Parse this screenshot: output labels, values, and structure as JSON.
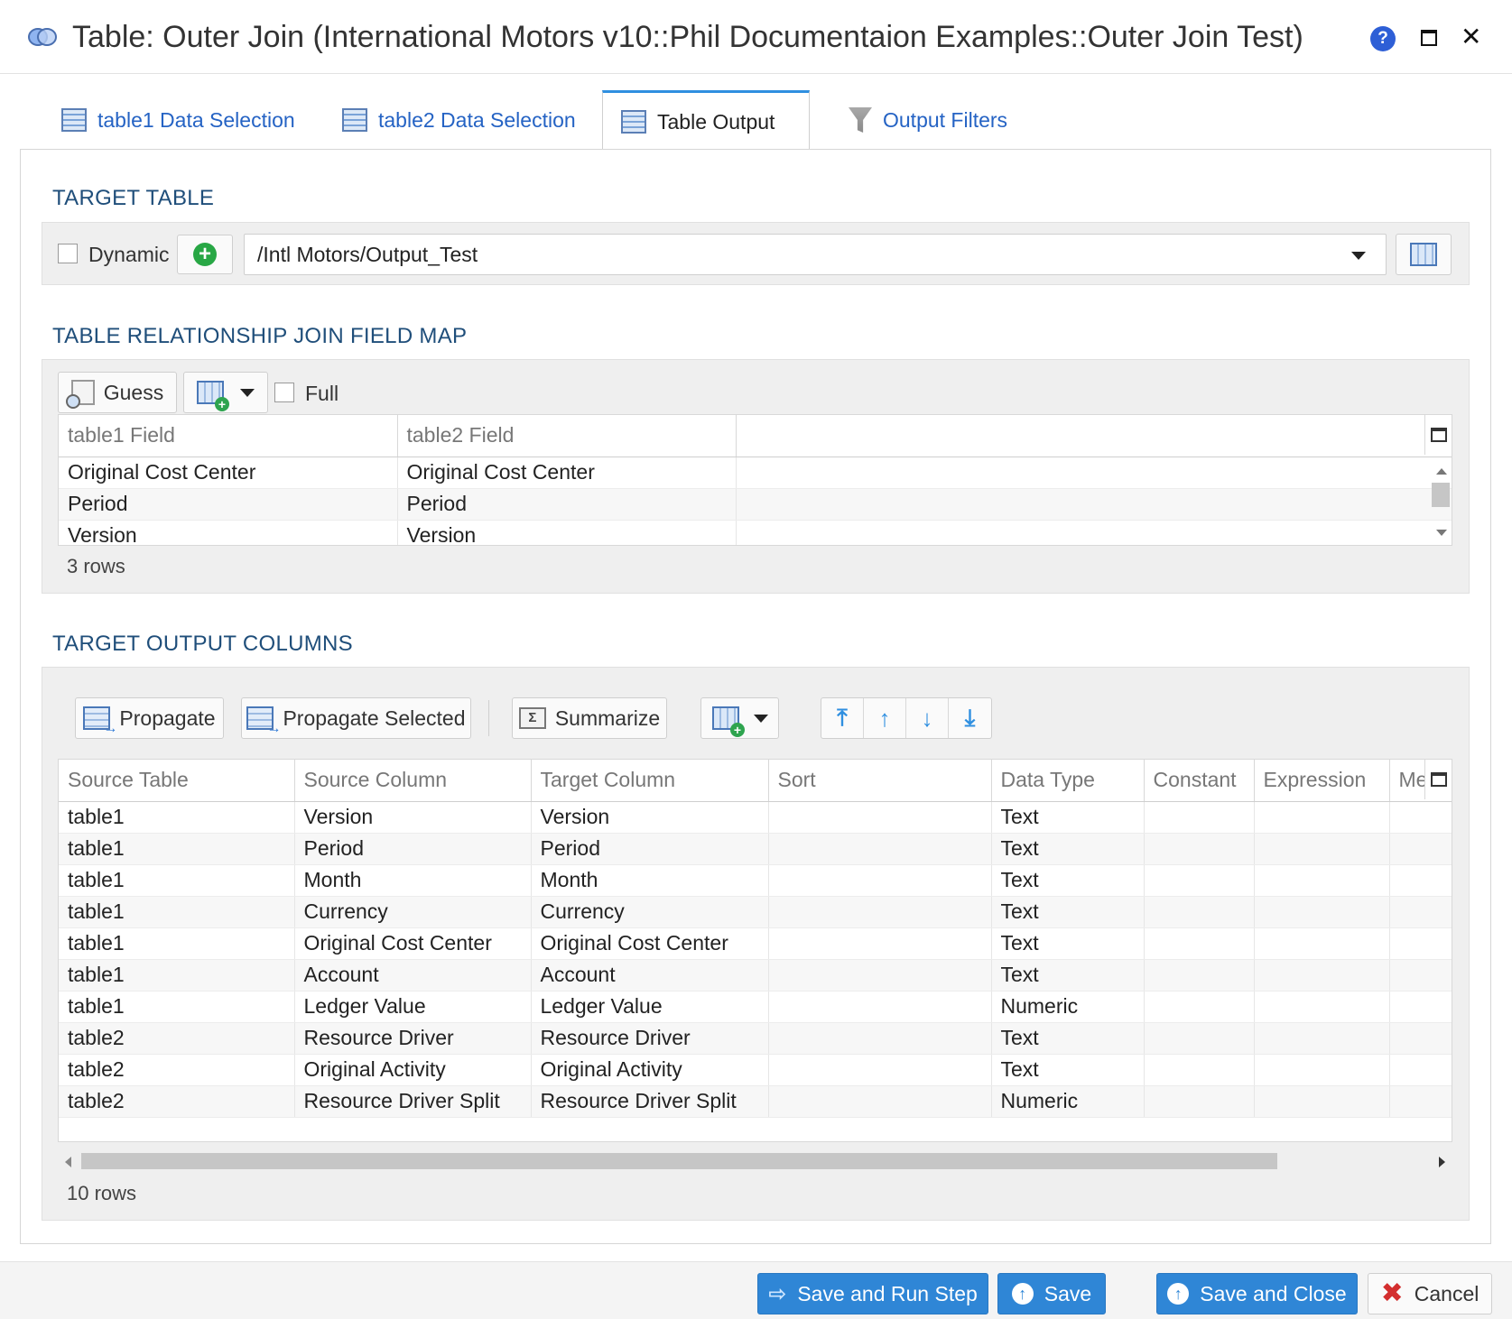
{
  "window": {
    "title": "Table: Outer Join (International Motors v10::Phil Documentaion Examples::Outer Join Test)",
    "help_label": "?"
  },
  "tabs": [
    {
      "label": "table1 Data Selection",
      "active": false
    },
    {
      "label": "table2 Data Selection",
      "active": false
    },
    {
      "label": "Table Output",
      "active": true
    },
    {
      "label": "Output Filters",
      "active": false
    }
  ],
  "target_table": {
    "heading": "TARGET TABLE",
    "dynamic_label": "Dynamic",
    "dynamic_checked": false,
    "selected_table": "/Intl Motors/Output_Test"
  },
  "join_map": {
    "heading": "TABLE RELATIONSHIP JOIN FIELD MAP",
    "guess_label": "Guess",
    "full_label": "Full",
    "full_checked": false,
    "columns": [
      "table1 Field",
      "table2 Field",
      ""
    ],
    "rows": [
      [
        "Original Cost Center",
        "Original Cost Center",
        ""
      ],
      [
        "Period",
        "Period",
        ""
      ],
      [
        "Version",
        "Version",
        ""
      ]
    ],
    "row_count": "3 rows"
  },
  "output_columns": {
    "heading": "TARGET OUTPUT COLUMNS",
    "propagate_label": "Propagate",
    "propagate_selected_label": "Propagate Selected",
    "summarize_label": "Summarize",
    "columns": [
      "Source Table",
      "Source Column",
      "Target Column",
      "Sort",
      "Data Type",
      "Constant",
      "Expression",
      "Me"
    ],
    "rows": [
      [
        "table1",
        "Version",
        "Version",
        "",
        "Text",
        "",
        "",
        ""
      ],
      [
        "table1",
        "Period",
        "Period",
        "",
        "Text",
        "",
        "",
        ""
      ],
      [
        "table1",
        "Month",
        "Month",
        "",
        "Text",
        "",
        "",
        ""
      ],
      [
        "table1",
        "Currency",
        "Currency",
        "",
        "Text",
        "",
        "",
        ""
      ],
      [
        "table1",
        "Original Cost Center",
        "Original Cost Center",
        "",
        "Text",
        "",
        "",
        ""
      ],
      [
        "table1",
        "Account",
        "Account",
        "",
        "Text",
        "",
        "",
        ""
      ],
      [
        "table1",
        "Ledger Value",
        "Ledger Value",
        "",
        "Numeric",
        "",
        "",
        ""
      ],
      [
        "table2",
        "Resource Driver",
        "Resource Driver",
        "",
        "Text",
        "",
        "",
        ""
      ],
      [
        "table2",
        "Original Activity",
        "Original Activity",
        "",
        "Text",
        "",
        "",
        ""
      ],
      [
        "table2",
        "Resource Driver Split",
        "Resource Driver Split",
        "",
        "Numeric",
        "",
        "",
        ""
      ]
    ],
    "row_count": "10 rows"
  },
  "footer": {
    "save_run_label": "Save and Run Step",
    "save_label": "Save",
    "save_close_label": "Save and Close",
    "cancel_label": "Cancel"
  },
  "colors": {
    "accent": "#2f86d6",
    "link": "#2563c4",
    "heading": "#1f4e7a"
  }
}
